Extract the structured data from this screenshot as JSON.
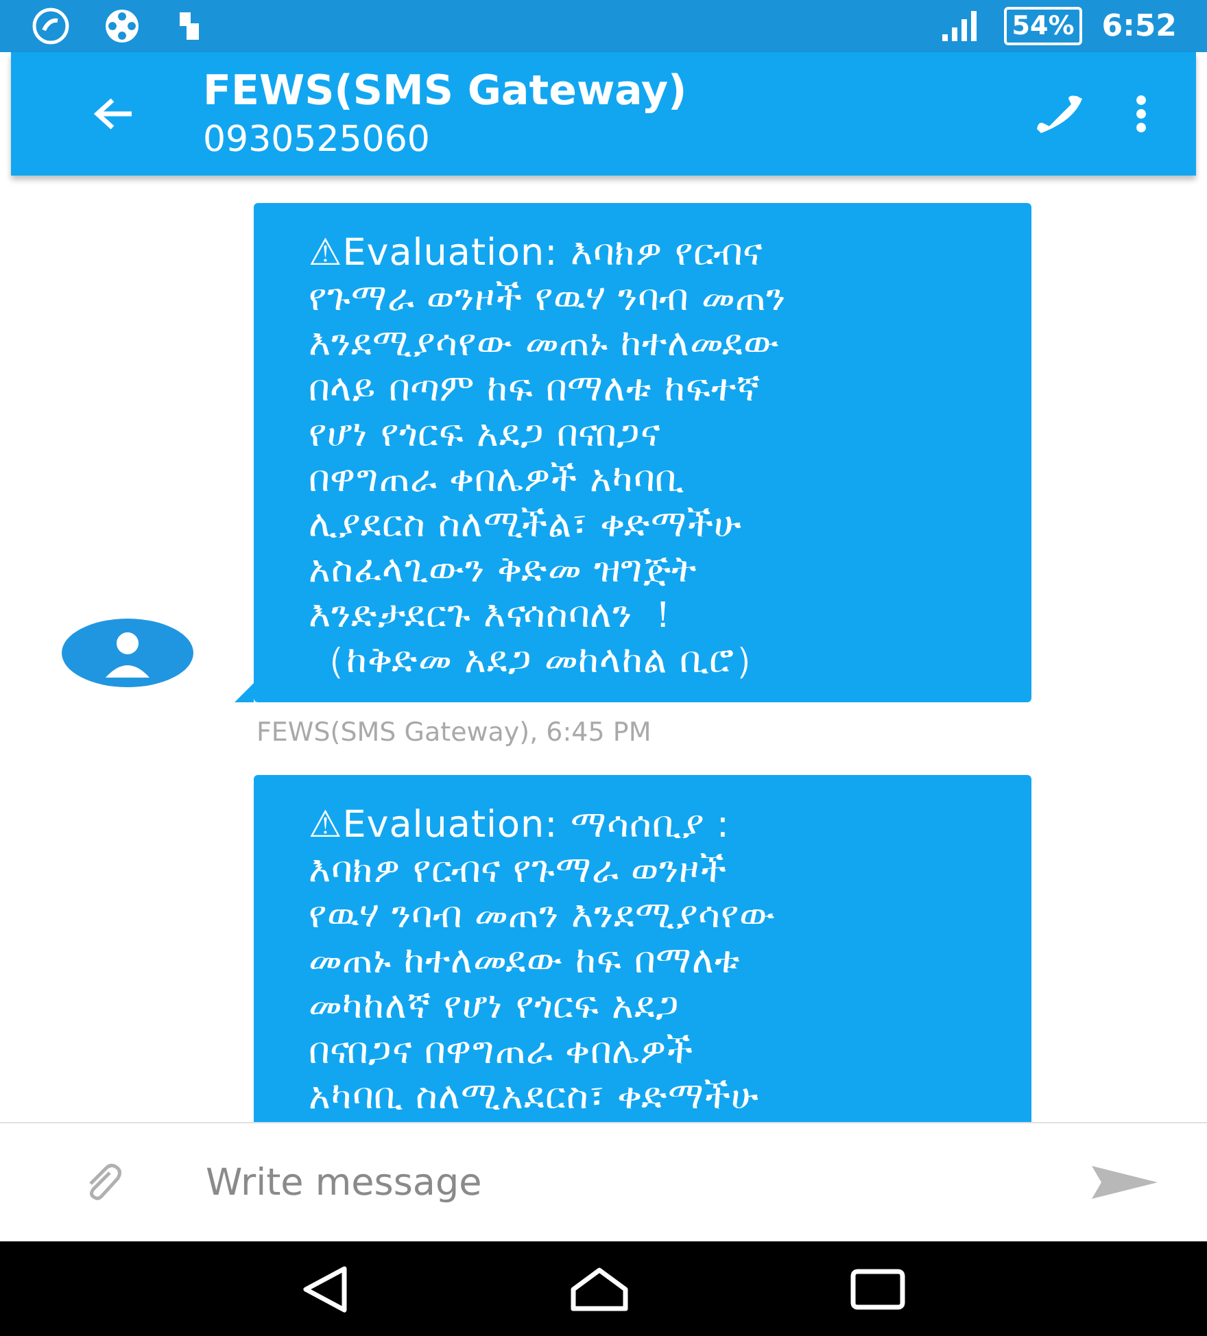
{
  "status_bar": {
    "battery": "54%",
    "time": "6:52"
  },
  "header": {
    "title": "FEWS(SMS Gateway)",
    "subtitle": "0930525060"
  },
  "messages": [
    {
      "lines": [
        "⚠Evaluation: እባክዎ  የርብና",
        "የጉማራ ወንዞች የዉሃ ንባብ መጠን",
        "እንደሚያሳየው መጠኑ ከተለመደው",
        "በላይ በጣም ከፍ በማለቱ ከፍተኛ",
        "የሆነ የጎርፍ አደጋ በናበጋና",
        "በዋግጠራ ቀበሌዎች አካባቢ",
        "ሊያደርስ ስለሚችል፣ ቀድማችሁ",
        "አስፈላጊውን ቅድመ ዝግጅት",
        "እንድታደርጉ እናሳስባለን ！",
        "（ከቅድመ አደጋ መከላከል ቢሮ）"
      ],
      "meta": "FEWS(SMS Gateway), 6:45 PM",
      "avatar": true
    },
    {
      "lines": [
        "⚠Evaluation: ማሳሰቢያ   :",
        "እባክዎ  የርብና  የጉማራ ወንዞች",
        "የዉሃ ንባብ መጠን እንደሚያሳየው",
        "መጠኑ ከተለመደው ከፍ በማለቱ",
        "መካከለኛ  የሆነ የጎርፍ አደጋ",
        "በናበጋና በዋግጠራ ቀበሌዎች",
        "አካባቢ ስለሚአደርስ፣ ቀድማችሁ"
      ],
      "avatar": false
    }
  ],
  "composer": {
    "placeholder": "Write message"
  }
}
